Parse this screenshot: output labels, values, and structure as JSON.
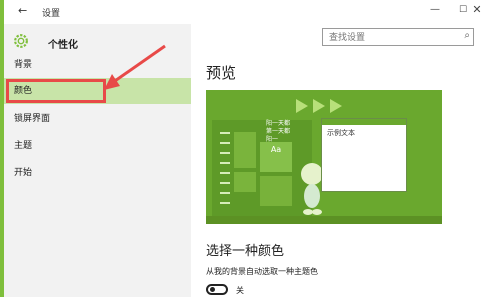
{
  "window": {
    "title": "设置",
    "back_icon": "←",
    "controls": {
      "minimize": "—",
      "maximize": "☐",
      "close": "✕"
    }
  },
  "sidebar": {
    "header": "个性化",
    "header_icon": "gear-icon",
    "items": [
      {
        "label": "背景"
      },
      {
        "label": "颜色",
        "selected": true
      },
      {
        "label": "锁屏界面"
      },
      {
        "label": "主题"
      },
      {
        "label": "开始"
      }
    ]
  },
  "search": {
    "placeholder": "查找设置",
    "icon": "search-icon"
  },
  "main": {
    "preview_heading": "预览",
    "preview": {
      "sample_text": "示例文本",
      "tile_label": "Aa",
      "banner_lines": [
        "阳一天都",
        "第一天都",
        "阳一"
      ]
    },
    "choose_color_heading": "选择一种颜色",
    "auto_pick_label": "从我的背景自动选取一种主题色",
    "toggle": {
      "state_label": "关",
      "on": false
    }
  },
  "colors": {
    "accent": "#7fbf3c",
    "selected_bg": "#c8e4a8",
    "annotation": "#e84a48",
    "preview_bg": "#6aa82e"
  }
}
